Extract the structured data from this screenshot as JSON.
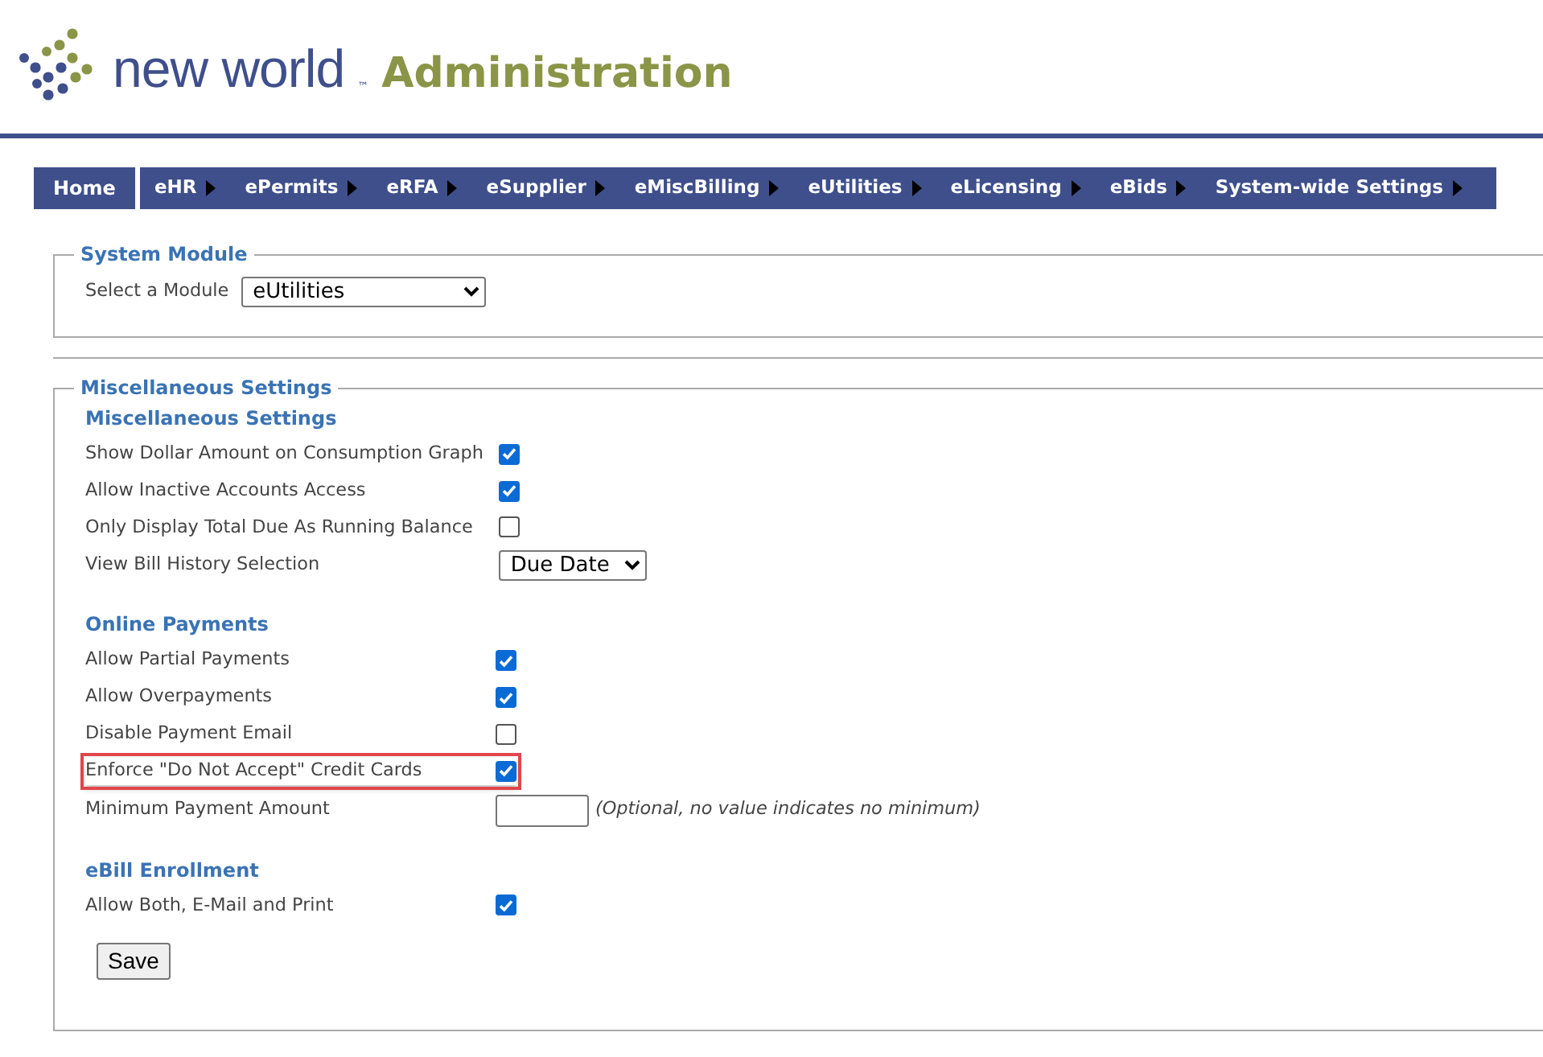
{
  "header": {
    "brand": "new world",
    "trademark": "™",
    "product": "Administration"
  },
  "menu": [
    {
      "label": "Home",
      "has_submenu": false
    },
    {
      "label": "eHR",
      "has_submenu": true
    },
    {
      "label": "ePermits",
      "has_submenu": true
    },
    {
      "label": "eRFA",
      "has_submenu": true
    },
    {
      "label": "eSupplier",
      "has_submenu": true
    },
    {
      "label": "eMiscBilling",
      "has_submenu": true
    },
    {
      "label": "eUtilities",
      "has_submenu": true
    },
    {
      "label": "eLicensing",
      "has_submenu": true
    },
    {
      "label": "eBids",
      "has_submenu": true
    },
    {
      "label": "System-wide Settings",
      "has_submenu": true
    }
  ],
  "system_module": {
    "legend": "System Module",
    "label": "Select a Module",
    "value": "eUtilities"
  },
  "misc": {
    "legend": "Miscellaneous Settings",
    "sections": [
      {
        "title": "Miscellaneous Settings",
        "rows": [
          {
            "kind": "checkbox",
            "label": "Show Dollar Amount on Consumption Graph",
            "checked": true,
            "highlighted": false
          },
          {
            "kind": "checkbox",
            "label": "Allow Inactive Accounts Access",
            "checked": true,
            "highlighted": false
          },
          {
            "kind": "checkbox",
            "label": "Only Display Total Due As Running Balance",
            "checked": false,
            "highlighted": false
          },
          {
            "kind": "select",
            "label": "View Bill History Selection",
            "value": "Due Date",
            "highlighted": false
          }
        ]
      },
      {
        "title": "Online Payments",
        "rows": [
          {
            "kind": "checkbox",
            "label": "Allow Partial Payments",
            "checked": true,
            "highlighted": false
          },
          {
            "kind": "checkbox",
            "label": "Allow Overpayments",
            "checked": true,
            "highlighted": false
          },
          {
            "kind": "checkbox",
            "label": "Disable Payment Email",
            "checked": false,
            "highlighted": false
          },
          {
            "kind": "checkbox",
            "label": "Enforce \"Do Not Accept\" Credit Cards",
            "checked": true,
            "highlighted": true
          },
          {
            "kind": "text",
            "label": "Minimum Payment Amount",
            "note": "(Optional, no value indicates no minimum)",
            "highlighted": false
          }
        ]
      },
      {
        "title": "eBill Enrollment",
        "rows": [
          {
            "kind": "checkbox",
            "label": "Allow Both, E-Mail and Print",
            "checked": true,
            "highlighted": false
          }
        ]
      }
    ],
    "save": "Save"
  }
}
